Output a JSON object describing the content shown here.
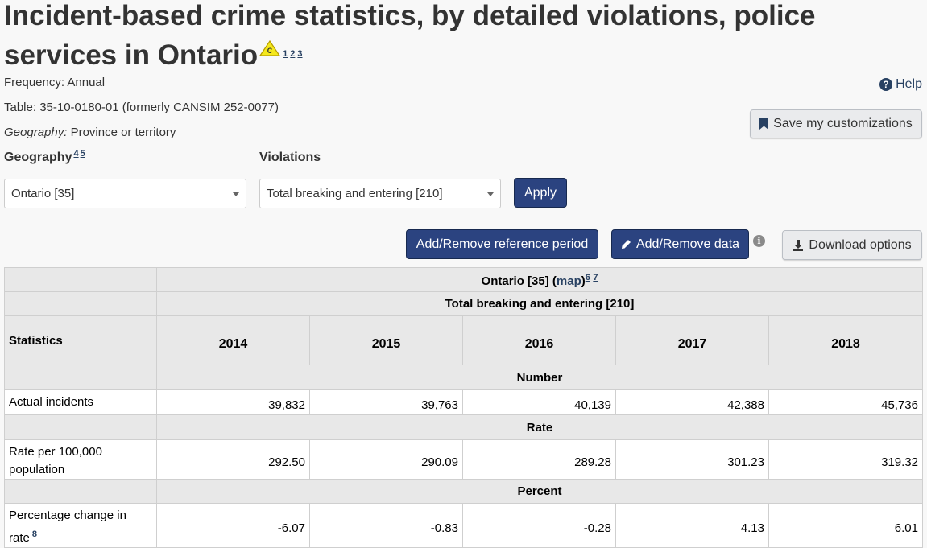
{
  "page": {
    "title": "Incident-based crime statistics, by detailed violations, police services in Ontario",
    "title_footnotes": [
      "1",
      "2",
      "3"
    ],
    "caution_symbol": "C",
    "frequency": "Frequency: Annual",
    "table_id": "Table: 35-10-0180-01 (formerly CANSIM 252-0077)",
    "geography_label": "Geography:",
    "geography_value": "Province or territory",
    "help_label": "Help",
    "help_icon": "?"
  },
  "controls": {
    "save_label": "Save my customizations",
    "geography": {
      "label": "Geography",
      "footnotes": [
        "4",
        "5"
      ],
      "selected": "Ontario [35]"
    },
    "violations": {
      "label": "Violations",
      "selected": "Total breaking and entering [210]"
    },
    "apply_label": "Apply",
    "add_remove_period_label": "Add/Remove reference period",
    "add_remove_data_label": "Add/Remove data",
    "info_icon": "i",
    "download_label": "Download options"
  },
  "table": {
    "geo_header": "Ontario [35]",
    "map_link": "map",
    "geo_footnotes": [
      "6",
      "7"
    ],
    "violation_header": "Total breaking and entering [210]",
    "stub_header": "Statistics",
    "years": [
      "2014",
      "2015",
      "2016",
      "2017",
      "2018"
    ],
    "sections": [
      {
        "heading": "Number",
        "rows": [
          {
            "label": "Actual incidents",
            "footnote": "",
            "values": [
              "39,832",
              "39,763",
              "40,139",
              "42,388",
              "45,736"
            ]
          }
        ]
      },
      {
        "heading": "Rate",
        "rows": [
          {
            "label": "Rate per 100,000 population",
            "footnote": "",
            "values": [
              "292.50",
              "290.09",
              "289.28",
              "301.23",
              "319.32"
            ]
          }
        ]
      },
      {
        "heading": "Percent",
        "rows": [
          {
            "label": "Percentage change in rate",
            "footnote": "8",
            "values": [
              "-6.07",
              "-0.83",
              "-0.28",
              "4.13",
              "6.01"
            ]
          }
        ]
      }
    ]
  },
  "colors": {
    "primary_button": "#2b4380",
    "link": "#284162",
    "title_rule": "#af3c43",
    "caution_yellow": "#f5e81c"
  }
}
